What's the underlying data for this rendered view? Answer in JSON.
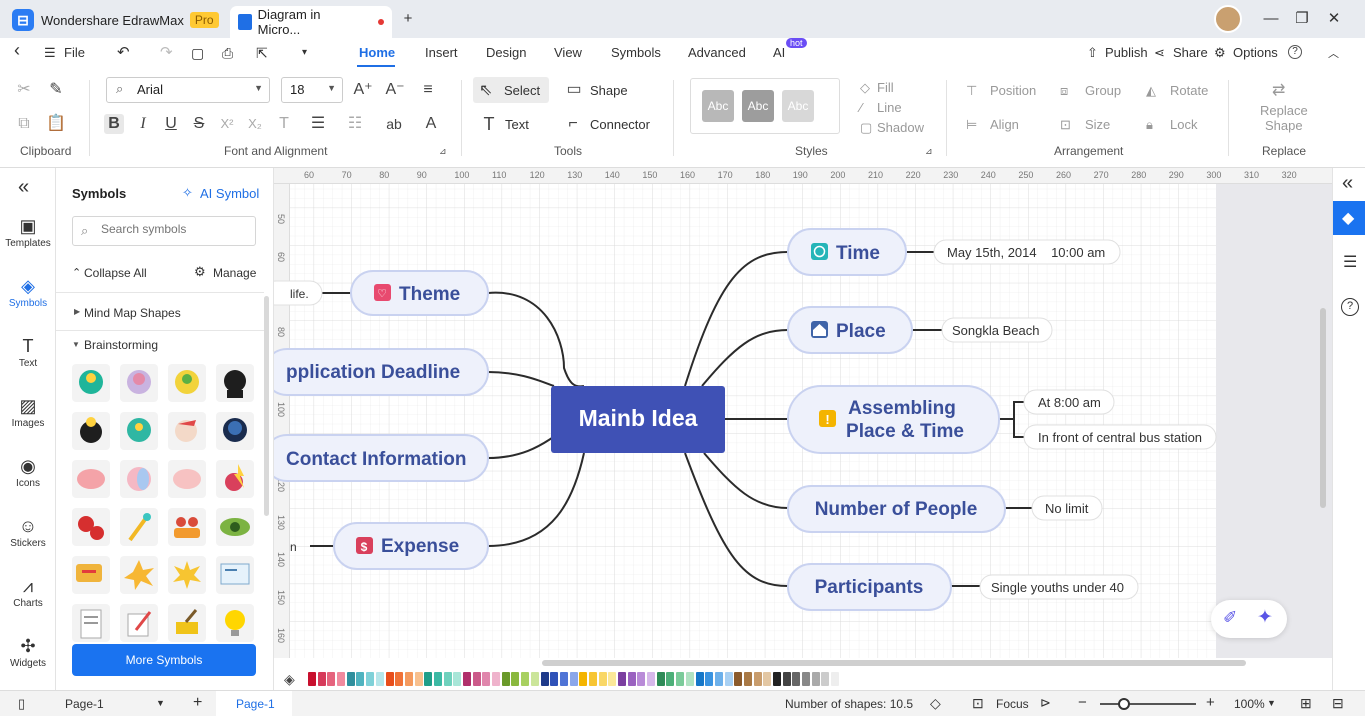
{
  "titlebar": {
    "app_name": "Wondershare EdrawMax",
    "badge": "Pro",
    "doc_tab": "Diagram in Micro...",
    "new_tab": "+",
    "minimize": "—",
    "maximize": "❐",
    "close": "✕"
  },
  "menu": {
    "back": "‹",
    "file": "File",
    "home": "Home",
    "insert": "Insert",
    "design": "Design",
    "view": "View",
    "symbols": "Symbols",
    "advanced": "Advanced",
    "ai": "AI",
    "ai_badge": "hot",
    "publish": "Publish",
    "share": "Share",
    "options": "Options",
    "help": "?"
  },
  "ribbon": {
    "clipboard_label": "Clipboard",
    "font_label": "Font and Alignment",
    "tools_label": "Tools",
    "styles_label": "Styles",
    "arrangement_label": "Arrangement",
    "replace_label": "Replace",
    "font_family": "Arial",
    "font_size": "18",
    "select": "Select",
    "shape": "Shape",
    "text": "Text",
    "connector": "Connector",
    "style_sample": "Abc",
    "fill": "Fill",
    "line": "Line",
    "shadow": "Shadow",
    "position": "Position",
    "group": "Group",
    "rotate": "Rotate",
    "align": "Align",
    "size": "Size",
    "lock": "Lock",
    "replace_shape_1": "Replace",
    "replace_shape_2": "Shape"
  },
  "leftbar": {
    "collapse": "«",
    "items": [
      {
        "label": "Templates",
        "icon": "template-icon",
        "glyph": "▣"
      },
      {
        "label": "Symbols",
        "icon": "symbols-icon",
        "glyph": "◈"
      },
      {
        "label": "Text",
        "icon": "text-icon",
        "glyph": "T"
      },
      {
        "label": "Images",
        "icon": "images-icon",
        "glyph": "▨"
      },
      {
        "label": "Icons",
        "icon": "icons-icon",
        "glyph": "◉"
      },
      {
        "label": "Stickers",
        "icon": "stickers-icon",
        "glyph": "☺"
      },
      {
        "label": "Charts",
        "icon": "charts-icon",
        "glyph": "⩘"
      },
      {
        "label": "Widgets",
        "icon": "widgets-icon",
        "glyph": "✣"
      }
    ]
  },
  "symbols_panel": {
    "title": "Symbols",
    "ai_symbol": "AI Symbol",
    "search_placeholder": "Search symbols",
    "collapse_all": "Collapse All",
    "manage": "Manage",
    "category_1": "Mind Map Shapes",
    "category_2": "Brainstorming",
    "more_symbols": "More Symbols"
  },
  "ruler": {
    "h_ticks": [
      "60",
      "70",
      "80",
      "90",
      "100",
      "110",
      "120",
      "130",
      "140",
      "150",
      "160",
      "170",
      "180",
      "190",
      "200",
      "210",
      "220",
      "230",
      "240",
      "250",
      "260",
      "270",
      "280",
      "290",
      "300",
      "310",
      "320"
    ],
    "v_ticks": [
      "50",
      "60",
      "70",
      "80",
      "90",
      "100",
      "110",
      "120",
      "130",
      "140",
      "150",
      "160"
    ]
  },
  "mindmap": {
    "center": "Mainb Idea",
    "left": [
      {
        "label": "Theme",
        "icon": "heart-icon",
        "note": "life."
      },
      {
        "label": "pplication Deadline",
        "icon": "",
        "note": ""
      },
      {
        "label": "Contact Information",
        "icon": "",
        "note": ""
      },
      {
        "label": "Expense",
        "icon": "dollar-icon",
        "note": "n"
      }
    ],
    "right": [
      {
        "label": "Time",
        "icon": "clock-icon",
        "notes": [
          "May 15th, 2014    10:00 am"
        ]
      },
      {
        "label": "Place",
        "icon": "house-icon",
        "notes": [
          "Songkla Beach"
        ]
      },
      {
        "label": "Assembling",
        "label2": "Place & Time",
        "icon": "exclamation-icon",
        "notes": [
          "At 8:00 am",
          "In front of central bus station"
        ]
      },
      {
        "label": "Number of People",
        "icon": "",
        "notes": [
          "No limit"
        ]
      },
      {
        "label": "Participants",
        "icon": "",
        "notes": [
          "Single youths under 40"
        ]
      }
    ]
  },
  "palette": [
    "#c8102e",
    "#d63a5a",
    "#e5637d",
    "#f08a9e",
    "#2f8f9d",
    "#4fb3bf",
    "#7fd1d8",
    "#b6e6ea",
    "#e84e1b",
    "#f07237",
    "#f49a5e",
    "#f8c08e",
    "#1f9e89",
    "#3cb9a4",
    "#6fd1bd",
    "#a8e6d8",
    "#b0306b",
    "#cc5a8a",
    "#e086ac",
    "#efb3cc",
    "#6a9a2a",
    "#8ab83e",
    "#a8d060",
    "#cbe59a",
    "#1e3a8a",
    "#2f52b8",
    "#4f74d6",
    "#8ba7ea",
    "#f4b400",
    "#f7c533",
    "#f9d766",
    "#fbe899",
    "#7b3fa0",
    "#9a62c0",
    "#b98bd8",
    "#d6b8ea",
    "#2e8b57",
    "#4caf78",
    "#7bcb9a",
    "#b0e2c2",
    "#1677c8",
    "#3a93e0",
    "#6db0ea",
    "#a8d0f3",
    "#8b5a2b",
    "#a97945",
    "#c89c6c",
    "#e3c7a3",
    "#222222",
    "#444444",
    "#666666",
    "#888888",
    "#aaaaaa",
    "#cccccc",
    "#eeeeee"
  ],
  "status": {
    "page_selector": "Page-1",
    "page_tab": "Page-1",
    "add_page": "+",
    "shapes": "Number of shapes: 10.5",
    "focus": "Focus",
    "zoom": "100%"
  }
}
